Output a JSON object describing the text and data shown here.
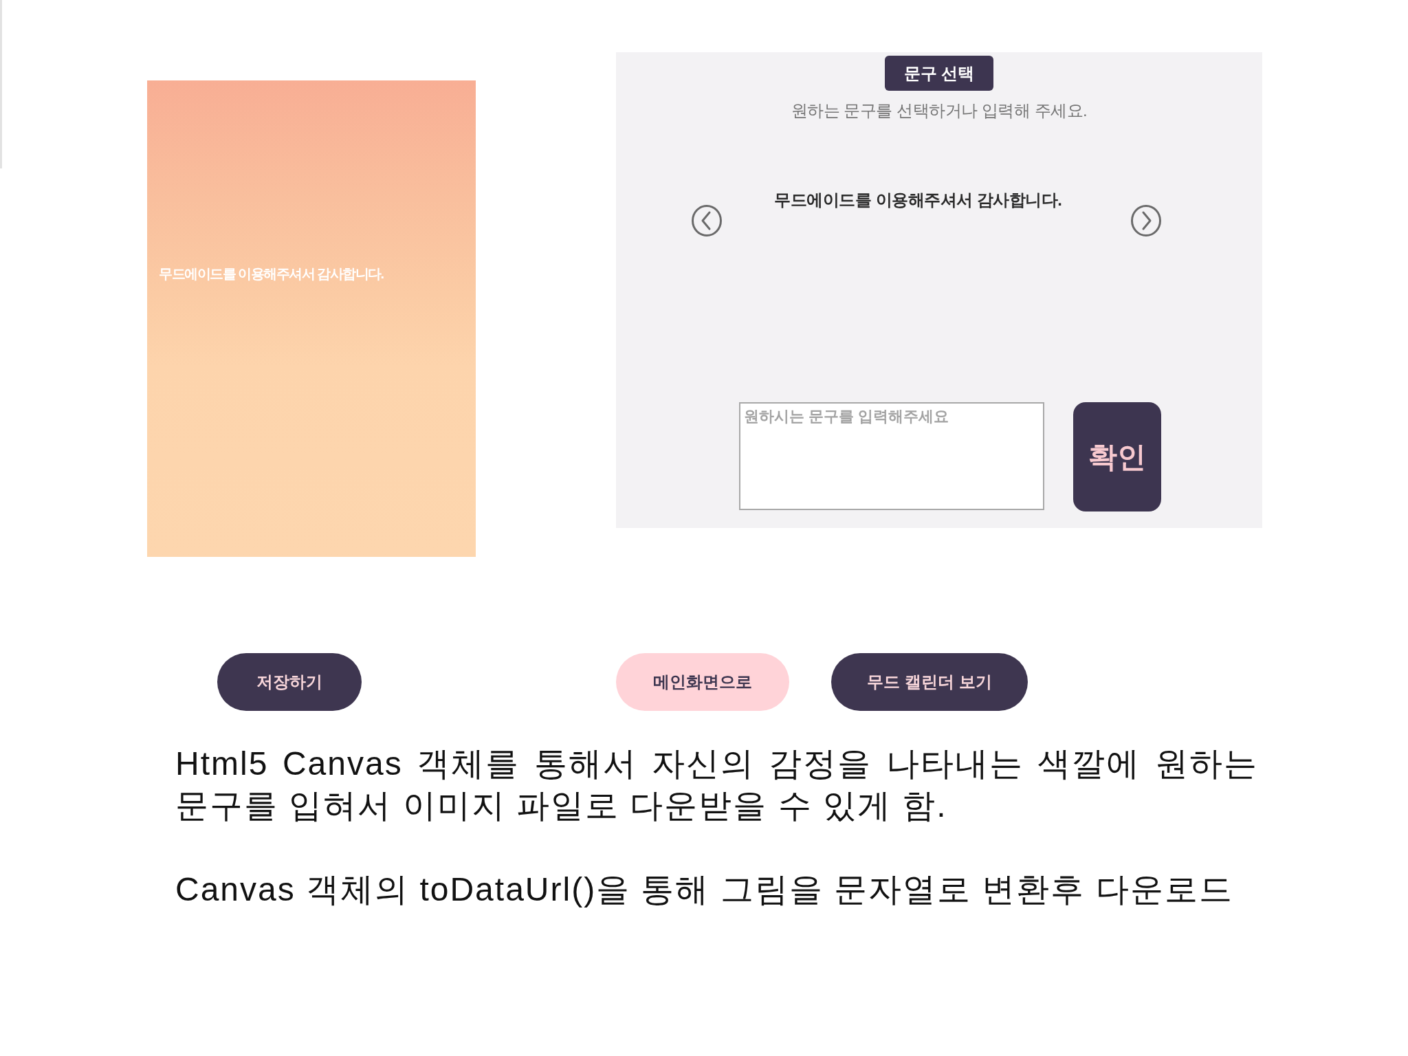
{
  "preview_card": {
    "caption": "무드에이드를 이용해주셔서 감사합니다."
  },
  "phrase_panel": {
    "title": "문구 선택",
    "instruction": "원하는 문구를 선택하거나 입력해 주세요.",
    "current_phrase": "무드에이드를 이용해주셔서 감사합니다.",
    "input": {
      "placeholder": "원하시는 문구를 입력해주세요"
    },
    "confirm_button": "확인"
  },
  "actions": [
    {
      "label": "저장하기",
      "kind": "primary"
    },
    {
      "label": "메인화면으로",
      "kind": "secondary"
    },
    {
      "label": "무드 캘린더 보기",
      "kind": "primary"
    }
  ],
  "description": [
    "Html5 Canvas 객체를 통해서 자신의 감정을 나타내는 색깔에 원하는 문구를 입혀서 이미지 파일로 다운받을 수 있게 함.",
    "Canvas 객체의 toDataUrl()을 통해 그림을 문자열로 변환후 다운로드"
  ]
}
